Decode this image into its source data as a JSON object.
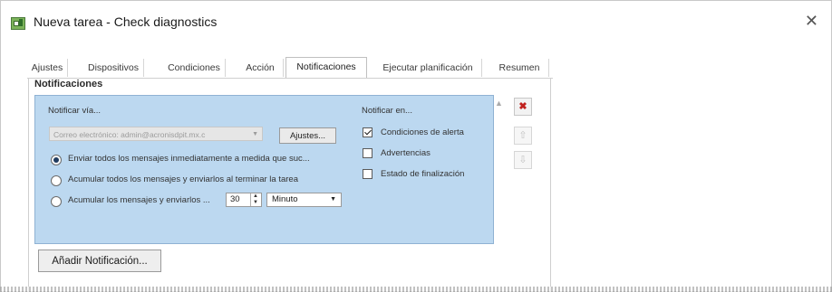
{
  "window": {
    "title": "Nueva tarea - Check diagnostics",
    "close_glyph": "✕"
  },
  "tabs": [
    {
      "label": "Ajustes"
    },
    {
      "label": "Dispositivos"
    },
    {
      "label": "Condiciones"
    },
    {
      "label": "Acción"
    },
    {
      "label": "Notificaciones",
      "active": true
    },
    {
      "label": "Ejecutar planificación"
    },
    {
      "label": "Resumen"
    }
  ],
  "section": {
    "title": "Notificaciones"
  },
  "notify_via": {
    "label": "Notificar vía...",
    "email_value": "Correo electrónico: admin@acronisdpit.mx.c",
    "settings_button": "Ajustes..."
  },
  "delivery": {
    "options": [
      {
        "label": "Enviar todos los mensajes inmediatamente a medida que suc...",
        "checked": true
      },
      {
        "label": "Acumular todos los mensajes y enviarlos al terminar la tarea",
        "checked": false
      },
      {
        "label": "Acumular los mensajes y enviarlos ...",
        "checked": false
      }
    ],
    "interval_value": "30",
    "interval_unit": "Minuto"
  },
  "notify_on": {
    "label": "Notificar en...",
    "options": [
      {
        "label": "Condiciones de alerta",
        "checked": true
      },
      {
        "label": "Advertencias",
        "checked": false
      },
      {
        "label": "Estado de finalización",
        "checked": false
      }
    ]
  },
  "add_notification_button": "Añadir Notificación...",
  "side_buttons": {
    "delete_glyph": "✖",
    "up_glyph": "⇧",
    "down_glyph": "⇩"
  },
  "colors": {
    "panel_bg": "#bcd8f0",
    "delete_icon": "#c0201e"
  }
}
